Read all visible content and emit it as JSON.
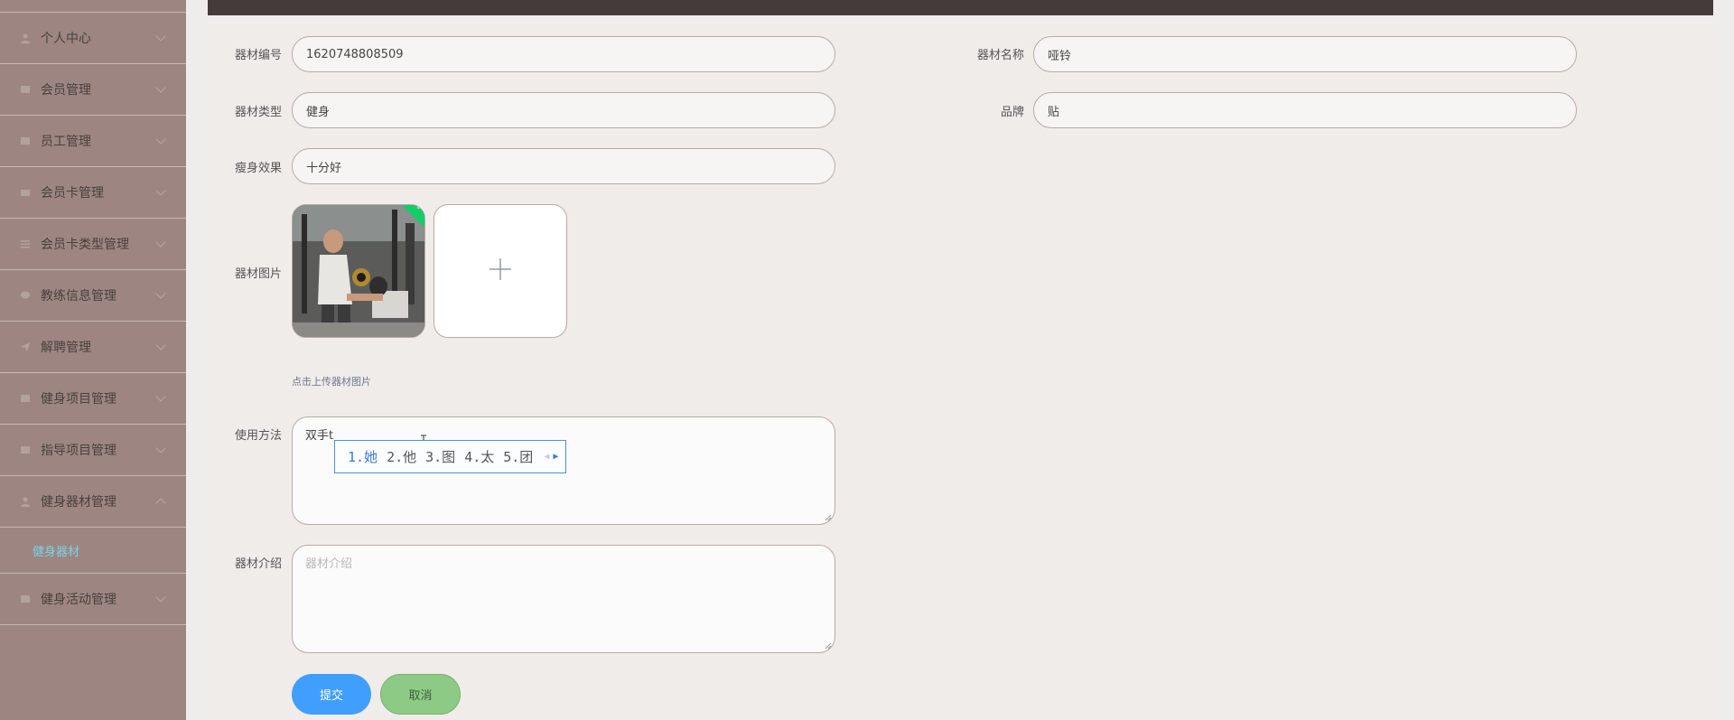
{
  "sidebar": {
    "items": [
      {
        "label": "个人中心",
        "icon": "user-icon"
      },
      {
        "label": "会员管理",
        "icon": "table-icon"
      },
      {
        "label": "员工管理",
        "icon": "table-icon"
      },
      {
        "label": "会员卡管理",
        "icon": "card-icon"
      },
      {
        "label": "会员卡类型管理",
        "icon": "list-icon"
      },
      {
        "label": "教练信息管理",
        "icon": "message-icon"
      },
      {
        "label": "解聘管理",
        "icon": "send-icon"
      },
      {
        "label": "健身项目管理",
        "icon": "table-icon"
      },
      {
        "label": "指导项目管理",
        "icon": "table-icon"
      },
      {
        "label": "健身器材管理",
        "icon": "user-icon"
      },
      {
        "label": "健身活动管理",
        "icon": "table-icon"
      }
    ],
    "submenu": {
      "label": "健身器材",
      "active_color": "#79d3e8"
    }
  },
  "form": {
    "equipment_no": {
      "label": "器材编号",
      "value": "1620748808509"
    },
    "equipment_name": {
      "label": "器材名称",
      "value": "哑铃"
    },
    "equipment_type": {
      "label": "器材类型",
      "value": "健身"
    },
    "brand": {
      "label": "品牌",
      "value": "贴"
    },
    "slim_effect": {
      "label": "瘦身效果",
      "value": "十分好"
    },
    "equipment_image": {
      "label": "器材图片",
      "hint": "点击上传器材图片"
    },
    "usage": {
      "label": "使用方法",
      "value": "双手t"
    },
    "intro": {
      "label": "器材介绍",
      "placeholder": "器材介绍"
    }
  },
  "ime": {
    "candidates": [
      "1.她",
      "2.他",
      "3.图",
      "4.太",
      "5.团"
    ]
  },
  "buttons": {
    "submit": "提交",
    "cancel": "取消"
  },
  "colors": {
    "sidebar_bg": "#9d8681",
    "topbar_bg": "#433c3a",
    "submit_bg": "#409eff",
    "cancel_bg": "#8dca86",
    "success_check": "#13ce66"
  }
}
